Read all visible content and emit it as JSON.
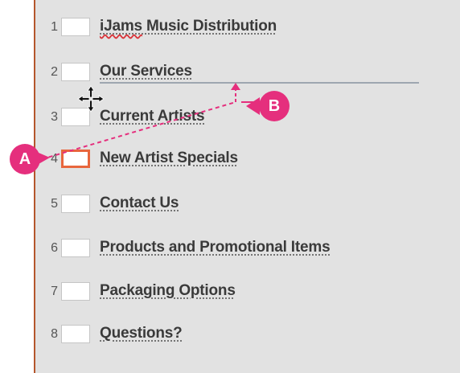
{
  "slides": [
    {
      "number": "1",
      "title": "iJams Music Distribution",
      "title_rest": " Music Distribution",
      "title_misspelled": "iJams"
    },
    {
      "number": "2",
      "title": "Our Services"
    },
    {
      "number": "3",
      "title": "Current Artists"
    },
    {
      "number": "4",
      "title": "New Artist Specials",
      "selected": true
    },
    {
      "number": "5",
      "title": "Contact Us"
    },
    {
      "number": "6",
      "title": "Products and Promotional Items"
    },
    {
      "number": "7",
      "title": "Packaging Options"
    },
    {
      "number": "8",
      "title": "Questions?"
    }
  ],
  "callouts": {
    "a": "A",
    "b": "B"
  },
  "colors": {
    "pane_background": "#e2e2e2",
    "selected_thumbnail_border": "#e8663d",
    "callout": "#e52f7d",
    "drop_indicator": "#9ea6b0",
    "pane_left_border": "#b5562c"
  },
  "icons": {
    "cursor": "move-cursor-icon"
  }
}
